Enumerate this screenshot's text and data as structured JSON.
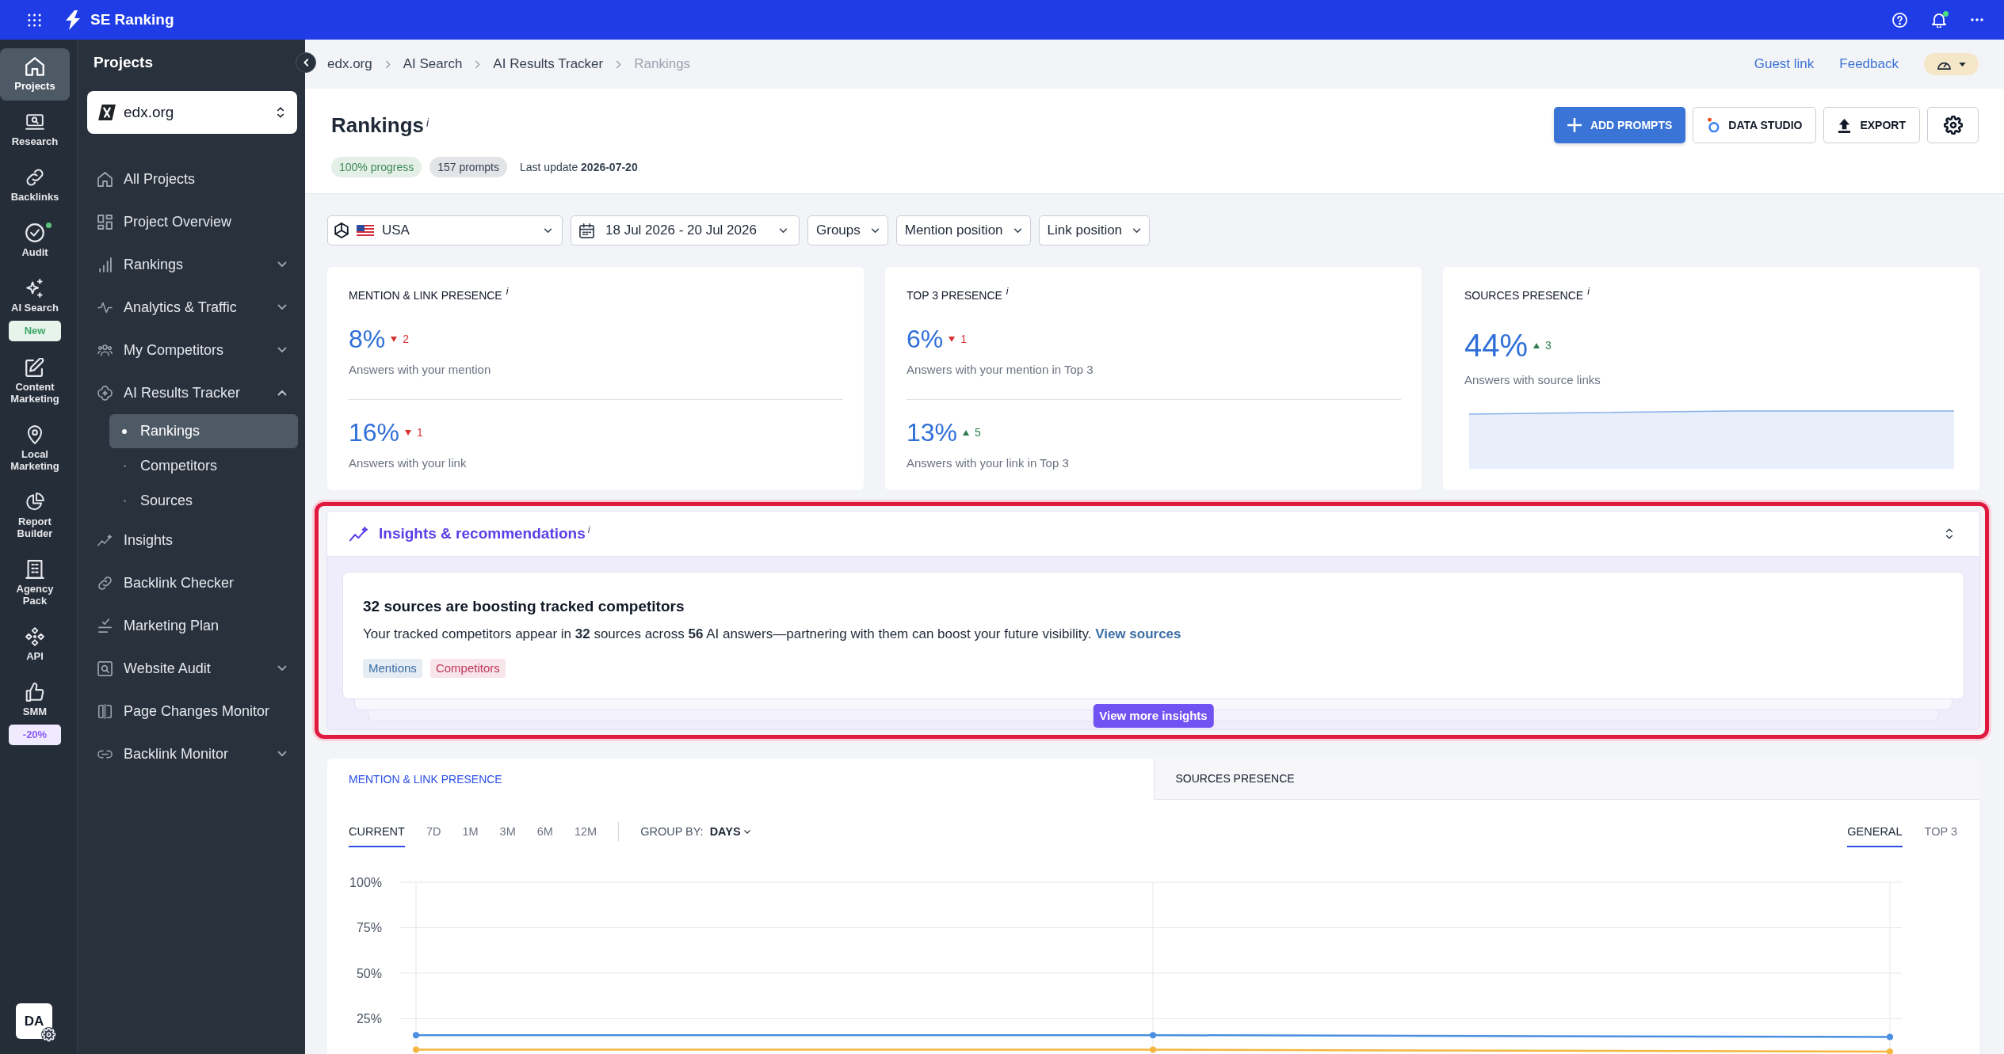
{
  "top_bar": {
    "app_name": "SE Ranking",
    "notifications": true
  },
  "icon_rail": {
    "items": [
      {
        "label": "Projects",
        "selected": true,
        "dot": false
      },
      {
        "label": "Research",
        "selected": false,
        "dot": false
      },
      {
        "label": "Backlinks",
        "selected": false,
        "dot": false
      },
      {
        "label": "Audit",
        "selected": false,
        "dot": true
      },
      {
        "label": "AI Search",
        "selected": false,
        "dot": false,
        "badge": {
          "text": "New",
          "color": "#3fa866"
        }
      },
      {
        "label": "Content Marketing",
        "selected": false,
        "dot": false
      },
      {
        "label": "Local Marketing",
        "selected": false,
        "dot": false
      },
      {
        "label": "Report Builder",
        "selected": false,
        "dot": false
      },
      {
        "label": "Agency Pack",
        "selected": false,
        "dot": false
      },
      {
        "label": "API",
        "selected": false,
        "dot": false
      },
      {
        "label": "SMM",
        "selected": false,
        "dot": false,
        "badge": {
          "text": "-20%",
          "color": "#8b5cf6"
        }
      }
    ],
    "avatar": "DA"
  },
  "sidebar": {
    "title": "Projects",
    "project": "edx.org",
    "items": [
      {
        "label": "All Projects",
        "kind": "link",
        "selected": false
      },
      {
        "label": "Project Overview",
        "kind": "link",
        "selected": false
      },
      {
        "label": "Rankings",
        "kind": "group",
        "selected": false,
        "expanded": false
      },
      {
        "label": "Analytics & Traffic",
        "kind": "group",
        "selected": false,
        "expanded": false
      },
      {
        "label": "My Competitors",
        "kind": "group",
        "selected": false,
        "expanded": false
      },
      {
        "label": "AI Results Tracker",
        "kind": "group",
        "selected": false,
        "expanded": true,
        "children": [
          {
            "label": "Rankings",
            "selected": true
          },
          {
            "label": "Competitors",
            "selected": false
          },
          {
            "label": "Sources",
            "selected": false
          }
        ]
      },
      {
        "label": "Insights",
        "kind": "link",
        "selected": false
      },
      {
        "label": "Backlink Checker",
        "kind": "link",
        "selected": false
      },
      {
        "label": "Marketing Plan",
        "kind": "link",
        "selected": false
      },
      {
        "label": "Website Audit",
        "kind": "group",
        "selected": false,
        "expanded": false
      },
      {
        "label": "Page Changes Monitor",
        "kind": "link",
        "selected": false
      },
      {
        "label": "Backlink Monitor",
        "kind": "group",
        "selected": false,
        "expanded": false
      }
    ]
  },
  "breadcrumb": [
    {
      "label": "edx.org",
      "current": false
    },
    {
      "label": "AI Search",
      "current": false
    },
    {
      "label": "AI Results Tracker",
      "current": false
    },
    {
      "label": "Rankings",
      "current": true
    }
  ],
  "header_links": [
    "Guest link",
    "Feedback"
  ],
  "page": {
    "title": "Rankings$^{i}$",
    "badges": [
      {
        "text": "100% progress",
        "color": "#3d8b57"
      },
      {
        "text": "157 prompts",
        "color": "#374151"
      }
    ],
    "last_update": "Last update **2026-07-20**",
    "actions": [
      {
        "kind": "primary",
        "label": "ADD PROMPTS"
      },
      {
        "kind": "data_studio",
        "label": "DATA STUDIO"
      },
      {
        "kind": "export",
        "label": "EXPORT"
      },
      {
        "kind": "settings"
      }
    ]
  },
  "filters": [
    {
      "kind": "engine",
      "label": "USA"
    },
    {
      "kind": "date",
      "label": "18 Jul 2026 - 20 Jul 2026"
    },
    {
      "kind": "select",
      "label": "Groups"
    },
    {
      "kind": "select",
      "label": "Mention position"
    },
    {
      "kind": "select",
      "label": "Link position"
    }
  ],
  "cards": [
    {
      "kind": "pair",
      "title": "MENTION & LINK PRESENCE$^{i}$",
      "metrics": [
        {
          "value": "8%",
          "rising": false,
          "change": "2",
          "caption": "Answers with your mention"
        },
        {
          "value": "16%",
          "rising": false,
          "change": "1",
          "caption": "Answers with your link"
        }
      ]
    },
    {
      "kind": "pair",
      "title": "TOP 3 PRESENCE$^{i}$",
      "metrics": [
        {
          "value": "6%",
          "rising": false,
          "change": "1",
          "caption": "Answers with your mention in Top 3"
        },
        {
          "value": "13%",
          "rising": true,
          "change": "5",
          "caption": "Answers with your link in Top 3"
        }
      ]
    },
    {
      "kind": "trend",
      "title": "SOURCES PRESENCE$^{i}$",
      "metrics": [
        {
          "value": "44%",
          "rising": true,
          "change": "3",
          "caption": "Answers with source links"
        }
      ]
    }
  ],
  "insights": {
    "highlighted": true,
    "title": "Insights & recommendations$^{i}$",
    "card": {
      "title": "32 sources are boosting tracked competitors",
      "text": "Your tracked competitors appear in **32** sources across **56** AI answers—partnering with them can boost your future visibility.",
      "link": "View sources",
      "tags": [
        {
          "text": "Mentions",
          "color": "#3a6ea5"
        },
        {
          "text": "Competitors",
          "color": "#c2345f"
        }
      ]
    },
    "more_button": "View more insights"
  },
  "trend_panel": {
    "tabs": [
      {
        "label": "MENTION & LINK PRESENCE",
        "selected": true
      },
      {
        "label": "SOURCES PRESENCE",
        "selected": false
      }
    ],
    "periods": [
      {
        "label": "CURRENT",
        "selected": true
      },
      {
        "label": "7D",
        "selected": false
      },
      {
        "label": "1M",
        "selected": false
      },
      {
        "label": "3M",
        "selected": false
      },
      {
        "label": "6M",
        "selected": false
      },
      {
        "label": "12M",
        "selected": false
      }
    ],
    "group_by": {
      "label": "GROUP BY:",
      "value": "DAYS"
    },
    "views": [
      {
        "label": "GENERAL",
        "selected": true
      },
      {
        "label": "TOP 3",
        "selected": false
      }
    ],
    "chart_data": {
      "type": "line",
      "grid": true,
      "ylim": [
        0,
        100
      ],
      "yticks": [
        {
          "value": 25,
          "label": "25%"
        },
        {
          "value": 50,
          "label": "50%"
        },
        {
          "value": 75,
          "label": "75%"
        },
        {
          "value": 100,
          "label": "100%"
        }
      ],
      "series": [
        {
          "color": "#4a8fe0",
          "marker": "circle",
          "values": [
            16,
            16,
            15
          ]
        },
        {
          "color": "#f4b63f",
          "marker": "circle",
          "values": [
            8,
            8,
            7
          ]
        }
      ]
    }
  }
}
